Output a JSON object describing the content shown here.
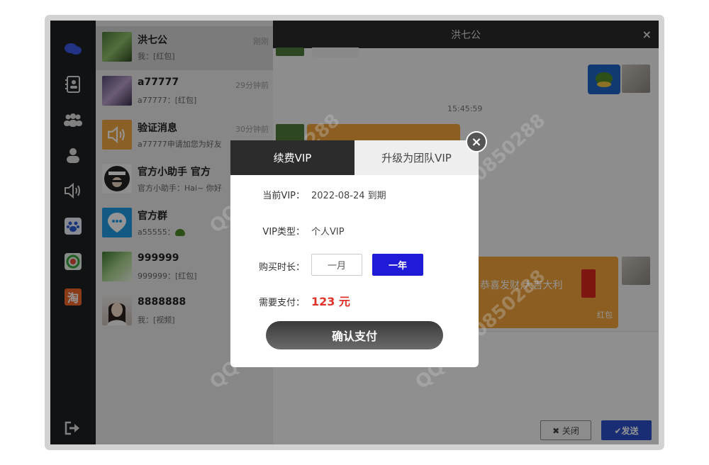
{
  "nav": {
    "items": [
      "chat-icon",
      "contacts-icon",
      "group-icon",
      "user-icon",
      "speaker-icon",
      "paw-icon",
      "baby-icon",
      "taobao-icon"
    ],
    "taobao_char": "淘",
    "logout": "logout-icon"
  },
  "conversations": [
    {
      "name": "洪七公",
      "time": "刚刚",
      "msg": "我：[红包]"
    },
    {
      "name": "a77777",
      "time": "29分钟前",
      "msg": "a77777：[红包]"
    },
    {
      "name": "验证消息",
      "time": "30分钟前",
      "msg": "a77777申请加您为好友"
    },
    {
      "name": "官方小助手 官方",
      "time": "",
      "msg": "官方小助手：Hai~ 你好"
    },
    {
      "name": "官方群",
      "time": "",
      "msg": "a55555："
    },
    {
      "name": "999999",
      "time": "",
      "msg": "999999：[红包]"
    },
    {
      "name": "8888888",
      "time": "",
      "msg": "我：[视频]"
    }
  ],
  "chat": {
    "title": "洪七公",
    "close": "×",
    "timestamp": "15:45:59",
    "redpacket_text": "恭喜发财,大吉大利",
    "redpacket_label": "红包",
    "close_button": "✖ 关闭",
    "send_button": "✔发送"
  },
  "modal": {
    "tabs": [
      "续费VIP",
      "升级为团队VIP"
    ],
    "close": "×",
    "labels": {
      "current_vip": "当前VIP：",
      "vip_type": "VIP类型：",
      "duration": "购买时长：",
      "pay": "需要支付："
    },
    "current_vip_value": "2022-08-24 到期",
    "vip_type_value": "个人VIP",
    "duration_options": [
      "一月",
      "一年"
    ],
    "selected_option": "一年",
    "price": "123 元",
    "confirm": "确认支付"
  },
  "watermark": "QQ:1570850288",
  "colors": {
    "rail": "#1e1f24",
    "accent_blue": "#1f1bd6",
    "send_blue": "#2a4ec8",
    "price_red": "#e0322b",
    "bubble_orange": "#f2a23a"
  }
}
